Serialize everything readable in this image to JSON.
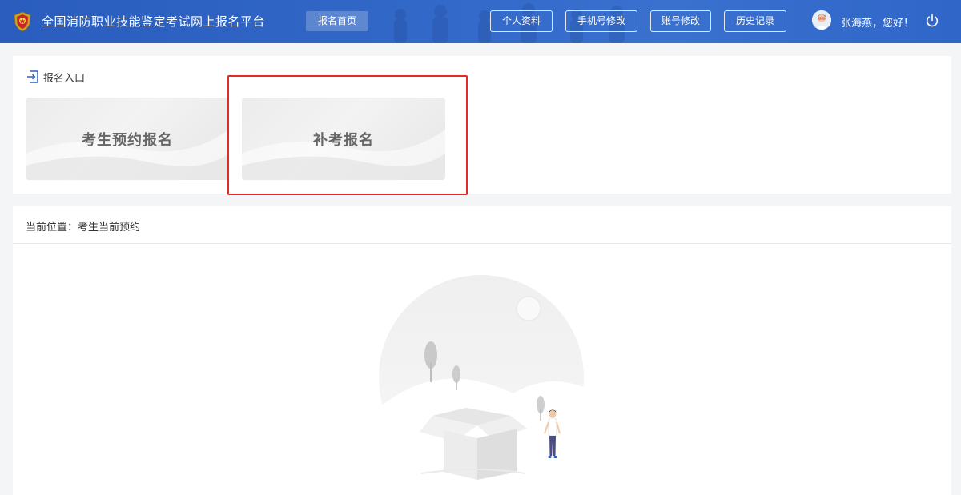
{
  "header": {
    "site_title": "全国消防职业技能鉴定考试网上报名平台",
    "nav_home": "报名首页",
    "buttons": [
      "个人资料",
      "手机号修改",
      "账号修改",
      "历史记录"
    ],
    "greeting": "张海燕，您好！",
    "icons": {
      "logo": "fire-emblem-icon",
      "avatar": "user-avatar",
      "power": "power-icon"
    }
  },
  "entry": {
    "title": "报名入口",
    "icon": "login-icon",
    "tiles": [
      "考生预约报名",
      "补考报名"
    ]
  },
  "content": {
    "breadcrumb": "当前位置：考生当前预约",
    "empty_illustration": "empty-box-illustration"
  },
  "colors": {
    "header_blue": "#3167c7",
    "highlight_red": "#e32a2a",
    "tile_text": "#666666"
  }
}
